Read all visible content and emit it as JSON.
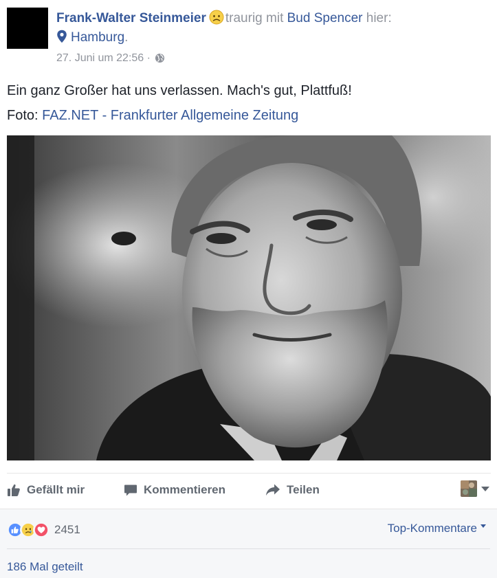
{
  "post": {
    "author": "Frank-Walter Steinmeier",
    "feeling": "traurig",
    "with_word": "mit",
    "tagged_person": "Bud Spencer",
    "here_word": "hier:",
    "location": "Hamburg",
    "location_suffix": ".",
    "timestamp": "27. Juni um 22:56",
    "separator": "·",
    "audience_icon": "globe-icon",
    "text": "Ein ganz Großer hat uns verlassen. Mach's gut, Plattfuß!",
    "credit_prefix": "Foto:",
    "credit_link": "FAZ.NET - Frankfurter Allgemeine Zeitung"
  },
  "actions": {
    "like_label": "Gefällt mir",
    "comment_label": "Kommentieren",
    "share_label": "Teilen"
  },
  "footer": {
    "reactions": [
      "like-icon",
      "sad-icon",
      "love-icon"
    ],
    "reaction_count": "2451",
    "top_comments_label": "Top-Kommentare",
    "shares_label": "186 Mal geteilt"
  },
  "colors": {
    "link": "#365899",
    "muted": "#90949c",
    "text": "#1d2129",
    "action_text": "#606770",
    "footer_bg": "#f6f7f9",
    "like_blue": "#5890ff",
    "sad_yellow": "#f7d04a",
    "love_red": "#f25268"
  }
}
